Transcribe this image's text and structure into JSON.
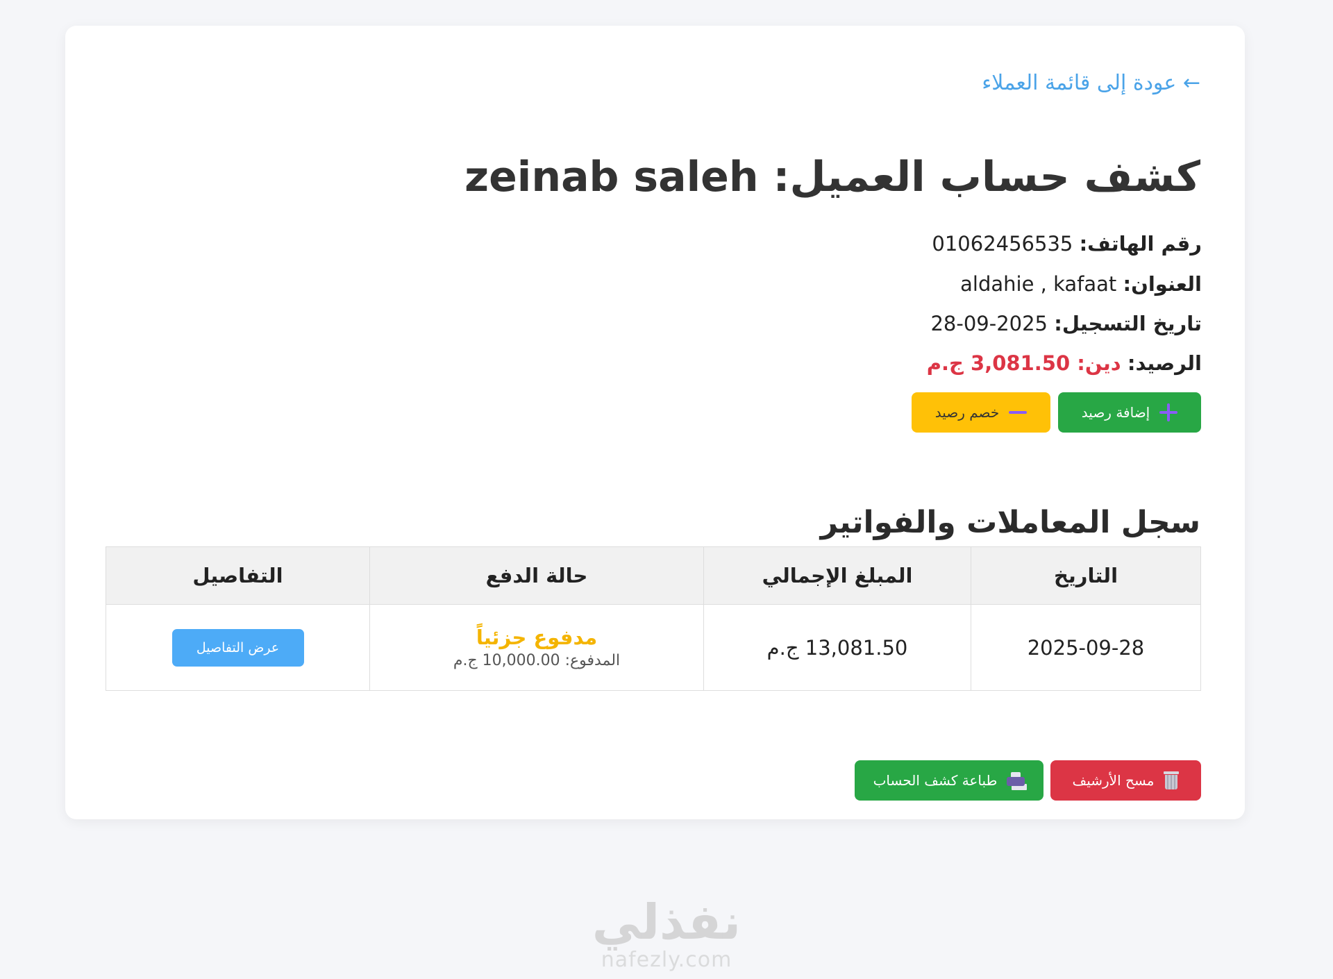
{
  "nav": {
    "back_label": "← عودة إلى قائمة العملاء"
  },
  "customer": {
    "title_prefix": "كشف حساب العميل:",
    "name": "zeinab saleh",
    "phone_label": "رقم الهاتف:",
    "phone": "01062456535",
    "address_label": "العنوان:",
    "address": "aldahie , kafaat",
    "registered_label": "تاريخ التسجيل:",
    "registered": "28-09-2025",
    "balance_label": "الرصيد:",
    "balance": "دين: 3,081.50 ج.م"
  },
  "balance_actions": {
    "add_label": "إضافة رصيد",
    "add_icon": "plus-icon",
    "subtract_label": "خصم رصيد",
    "subtract_icon": "minus-icon"
  },
  "transactions": {
    "title": "سجل المعاملات والفواتير",
    "columns": [
      "التاريخ",
      "المبلغ الإجمالي",
      "حالة الدفع",
      "التفاصيل"
    ],
    "rows": [
      {
        "date": "2025-09-28",
        "total": "13,081.50 ج.م",
        "status": "مدفوع جزئياً",
        "paid_label": "المدفوع:",
        "paid": "10,000.00 ج.م",
        "details_label": "عرض التفاصيل"
      }
    ]
  },
  "footer_actions": {
    "print_label": "طباعة كشف الحساب",
    "print_icon": "printer-icon",
    "clear_label": "مسح الأرشيف",
    "clear_icon": "trash-icon"
  },
  "watermark": {
    "logo": "نفذلي",
    "url": "nafezly.com"
  },
  "colors": {
    "page_background": "#f5f6f9",
    "link": "#4aa3e8",
    "debt": "#dc3545",
    "success": "#28a745",
    "warning": "#ffc107",
    "partial_status": "#f4b400",
    "details_button": "#4dabf7"
  }
}
